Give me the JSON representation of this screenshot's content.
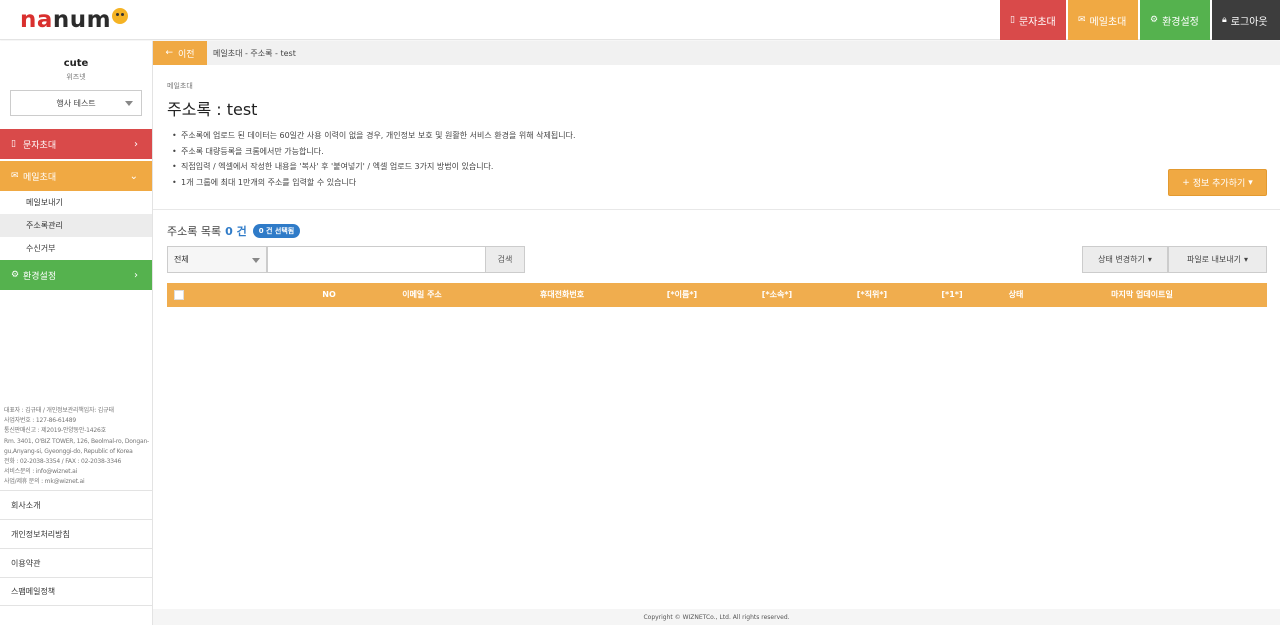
{
  "logo": {
    "part1": "na",
    "part2": "num"
  },
  "topnav": {
    "sms": "문자초대",
    "mail": "메일초대",
    "env": "환경설정",
    "logout": "로그아웃"
  },
  "sidebar": {
    "user_name": "cute",
    "user_sub": "위즈넷",
    "select_value": "행사 테스트",
    "menu": {
      "sms": "문자초대",
      "mail": "메일초대",
      "env": "환경설정"
    },
    "sub_items": [
      "메일보내기",
      "주소록관리",
      "수신거부"
    ],
    "company_info": [
      "대표자 : 김규태 / 개인정보관리책임자: 김규태",
      "사업자번호 : 127-86-61489",
      "통신판매신고 : 제2019-안양동안-1426호",
      "Rm. 3401, O'BIZ TOWER, 126, Beolmal-ro, Dongan-",
      "gu,Anyang-si, Gyeonggi-do, Republic of Korea",
      "전화 : 02-2038-3354 / FAX : 02-2038-3346",
      "서비스문의 : info@wiznet.ai",
      "사업/제휴 문의 : mk@wiznet.ai"
    ],
    "footer_links": [
      "회사소개",
      "개인정보처리방침",
      "이용약관",
      "스팸메일정책"
    ]
  },
  "breadcrumb": {
    "back_label": "이전",
    "path": "메일초대 - 주소록 - test"
  },
  "main": {
    "section_sub": "메일초대",
    "title": "주소록 : test",
    "notes": [
      "주소록에 업로드 된 데이터는 60일간 사용 이력이 없을 경우, 개인정보 보호 및 원활한 서비스 환경을 위해 삭제됩니다.",
      "주소록 대량등록을 크롬에서만 가능합니다.",
      "직접입력 / 엑셀에서 작성한 내용을 '복사' 후 '붙여넣기' / 엑셀 업로드 3가지 방법이 있습니다.",
      "1개 그룹에 최대 1만개의 주소를 입력할 수 있습니다"
    ],
    "add_button": "정보 추가하기",
    "list_title": "주소록 목록",
    "list_count": "0 건",
    "selected_badge": "0 건 선택됨",
    "filter_value": "전체",
    "search_placeholder": "",
    "search_button": "검색",
    "status_button": "상태 변경하기",
    "export_button": "파일로 내보내기",
    "table_headers": [
      "NO",
      "이메일 주소",
      "휴대전화번호",
      "[*이름*]",
      "[*소속*]",
      "[*직위*]",
      "[*1*]",
      "상태",
      "마지막 업데이트일"
    ]
  },
  "copyright": "Copyright © WIZNETCo., Ltd. All rights reserved.",
  "colors": {
    "sms": "#d94a4a",
    "mail": "#f0a943",
    "env": "#55b24e",
    "logout": "#3d3d3d",
    "badge": "#2f7bc8"
  }
}
